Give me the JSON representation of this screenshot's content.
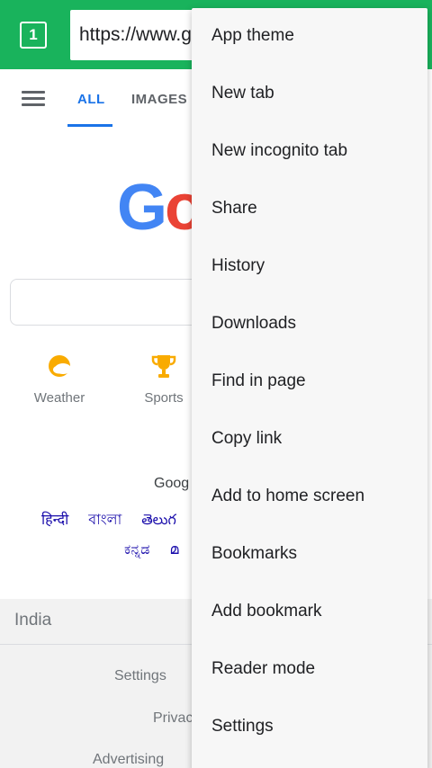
{
  "browser": {
    "tab_count": "1",
    "url": "https://www.google.com"
  },
  "nav": {
    "tabs": [
      {
        "label": "ALL"
      },
      {
        "label": "IMAGES"
      }
    ]
  },
  "logo": {
    "g": "G",
    "o": "o"
  },
  "shortcuts": [
    {
      "label": "Weather",
      "icon": "weather-sun-cloud-icon"
    },
    {
      "label": "Sports",
      "icon": "trophy-icon"
    }
  ],
  "languages": {
    "offered_in": "Goog",
    "row1": [
      "हिन्दी",
      "বাংলা",
      "తెలుగ"
    ],
    "row2": [
      "ಕನ್ನಡ",
      "മ"
    ]
  },
  "footer": {
    "region": "India",
    "links": [
      "Settings",
      "Privac",
      "Advertising"
    ]
  },
  "menu": {
    "items": [
      {
        "label": "App theme"
      },
      {
        "label": "New tab"
      },
      {
        "label": "New incognito tab"
      },
      {
        "label": "Share"
      },
      {
        "label": "History"
      },
      {
        "label": "Downloads"
      },
      {
        "label": "Find in page"
      },
      {
        "label": "Copy link"
      },
      {
        "label": "Add to home screen"
      },
      {
        "label": "Bookmarks"
      },
      {
        "label": "Add bookmark"
      },
      {
        "label": "Reader mode"
      },
      {
        "label": "Settings"
      }
    ]
  },
  "colors": {
    "toolbar": "#19b35c",
    "accent_blue": "#1a73e8",
    "menu_bg": "#f7f7f7"
  }
}
